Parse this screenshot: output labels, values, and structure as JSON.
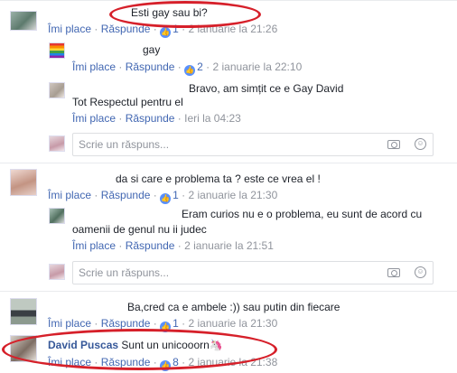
{
  "actions": {
    "like": "Îmi place",
    "reply": "Răspunde",
    "dot": "·"
  },
  "reply_box": {
    "placeholder": "Scrie un răspuns..."
  },
  "comments": [
    {
      "author": "",
      "text": "Esti gay sau bi?",
      "likes": "1",
      "time": "2 ianuarie la 21:26"
    },
    {
      "author": "",
      "text": "gay",
      "likes": "2",
      "time": "2 ianuarie la 22:10"
    },
    {
      "author": "",
      "text": "Bravo, am simțit ce e Gay David",
      "text2": "Tot Respectul pentru el",
      "likes": "",
      "time": "Ieri la 04:23"
    },
    {
      "author": "",
      "text": "da si care e problema ta ? este ce vrea el !",
      "likes": "1",
      "time": "2 ianuarie la 21:30"
    },
    {
      "author": "",
      "text": "Eram curios nu e o problema, eu sunt de acord cu",
      "text2": "oamenii de genul nu ii judec",
      "likes": "",
      "time": "2 ianuarie la 21:51"
    },
    {
      "author": "",
      "text": "Ba,cred ca e ambele :)) sau putin din fiecare",
      "likes": "1",
      "time": "2 ianuarie la 21:30"
    },
    {
      "author": "David Puscas",
      "text": "Sunt un unicooorn",
      "likes": "8",
      "time": "2 ianuarie la 21:38"
    }
  ],
  "icons": {
    "camera": "camera-icon",
    "emoji": "emoji-icon",
    "like": "like-thumb-icon",
    "unicorn": "unicorn-emoji"
  },
  "colors": {
    "link": "#4267b2",
    "author": "#365899",
    "highlight": "#d6202a",
    "like_badge": "#5890ff"
  }
}
